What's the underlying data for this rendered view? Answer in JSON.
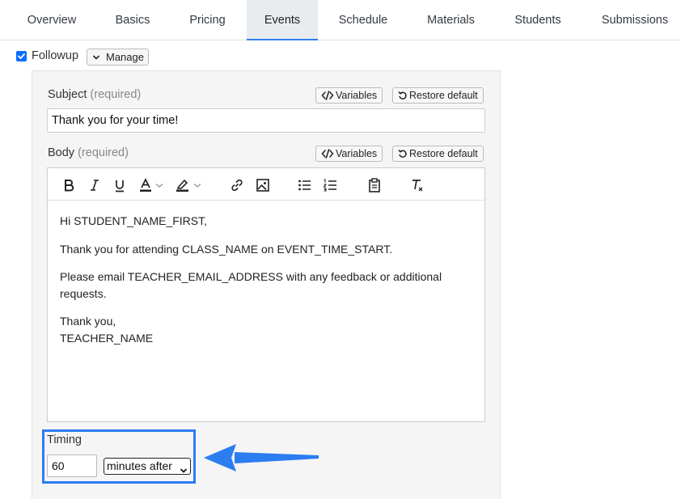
{
  "tabs": [
    {
      "label": "Overview"
    },
    {
      "label": "Basics"
    },
    {
      "label": "Pricing"
    },
    {
      "label": "Events",
      "active": true
    },
    {
      "label": "Schedule"
    },
    {
      "label": "Materials"
    },
    {
      "label": "Students"
    },
    {
      "label": "Submissions"
    }
  ],
  "followup": {
    "label": "Followup",
    "checked": true,
    "manage_label": "Manage"
  },
  "subject": {
    "label": "Subject",
    "required": "(required)",
    "variables_label": "Variables",
    "restore_label": "Restore default",
    "value": "Thank you for your time!"
  },
  "body": {
    "label": "Body",
    "required": "(required)",
    "variables_label": "Variables",
    "restore_label": "Restore default",
    "toolbar": [
      "bold-icon",
      "italic-icon",
      "underline-icon",
      "text-color-icon",
      "highlight-color-icon",
      "link-icon",
      "image-icon",
      "bulleted-list-icon",
      "numbered-list-icon",
      "paste-icon",
      "clear-formatting-icon"
    ],
    "paragraphs": {
      "greeting": "Hi STUDENT_NAME_FIRST,",
      "thanks": "Thank you for attending CLASS_NAME on EVENT_TIME_START.",
      "feedback": "Please email TEACHER_EMAIL_ADDRESS with any feedback or additional requests.",
      "signoff_line1": "Thank you,",
      "signoff_line2": "TEACHER_NAME"
    }
  },
  "timing": {
    "label": "Timing",
    "value": "60",
    "unit_selected": "minutes after"
  },
  "colors": {
    "accent": "#2b7df0",
    "checkbox": "#0d6efd",
    "panel_bg": "#f5f5f5"
  }
}
